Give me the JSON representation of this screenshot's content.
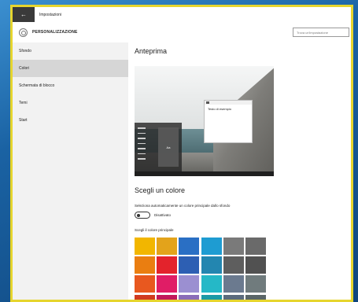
{
  "window": {
    "app_title": "Impostazioni",
    "back_glyph": "←"
  },
  "header": {
    "title": "PERSONALIZZAZIONE",
    "search_placeholder": "Trova un'impostazione"
  },
  "sidebar": {
    "items": [
      {
        "label": "Sfondo",
        "active": false
      },
      {
        "label": "Colori",
        "active": true
      },
      {
        "label": "Schermata di blocco",
        "active": false
      },
      {
        "label": "Temi",
        "active": false
      },
      {
        "label": "Start",
        "active": false
      }
    ]
  },
  "main": {
    "preview_heading": "Anteprima",
    "preview_sample_text": "Testo di esempio",
    "preview_tile_text": "Aa",
    "color_heading": "Scegli un colore",
    "auto_accent_label": "Seleziona automaticamente un colore principale dallo sfondo",
    "toggle_state": "Disattivato",
    "toggle_on": false,
    "accent_label": "Scegli il colore principale",
    "swatches": [
      "#f2b600",
      "#e3a31b",
      "#2a6fc4",
      "#1e9cd2",
      "#7a7a7a",
      "#6a6a6a",
      "#ea7e11",
      "#e3232c",
      "#2d5fb3",
      "#2386b0",
      "#5e5e5e",
      "#515151",
      "#e8581f",
      "#e01d66",
      "#9b8fd1",
      "#25b8c7",
      "#6b7a8f",
      "#707b7d",
      "#d13b1f",
      "#c2185b",
      "#8a6db8",
      "#1c9aa6",
      "#5b6b7d",
      "#5a6668"
    ]
  }
}
